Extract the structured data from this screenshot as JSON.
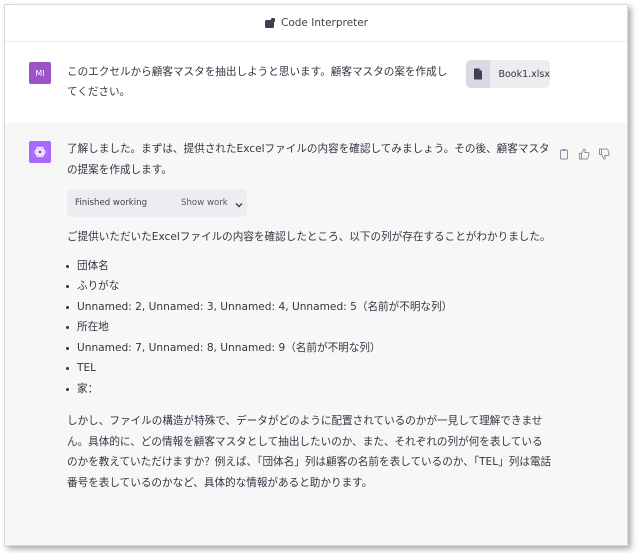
{
  "topbar": {
    "title": "Code Interpreter",
    "icon": "plugin-icon"
  },
  "user": {
    "avatar": "MI",
    "message": "このエクセルから顧客マスタを抽出しようと思います。顧客マスタの案を作成してください。",
    "file": {
      "name": "Book1.xlsx",
      "icon": "file-icon"
    }
  },
  "assistant": {
    "intro": "了解しました。まずは、提供されたExcelファイルの内容を確認してみましょう。その後、顧客マスタの提案を作成します。",
    "working": {
      "status": "Finished working",
      "toggle": "Show work"
    },
    "found": "ご提供いただいたExcelファイルの内容を確認したところ、以下の列が存在することがわかりました。",
    "columns": [
      "団体名",
      "ふりがな",
      "Unnamed: 2, Unnamed: 3, Unnamed: 4, Unnamed: 5（名前が不明な列）",
      "所在地",
      "Unnamed: 7, Unnamed: 8, Unnamed: 9（名前が不明な列）",
      "TEL",
      "家："
    ],
    "closing": "しかし、ファイルの構造が特殊で、データがどのように配置されているのかが一見して理解できません。具体的に、どの情報を顧客マスタとして抽出したいのか、また、それぞれの列が何を表しているのかを教えていただけますか？例えば、「団体名」列は顧客の名前を表しているのか、「TEL」列は電話番号を表しているのかなど、具体的な情報があると助かります。",
    "feedback": [
      "copy-icon",
      "thumbs-up-icon",
      "thumbs-down-icon"
    ]
  },
  "colors": {
    "user_avatar": "#9a54c6",
    "gpt_avatar": "#ab68ff",
    "assistant_bg": "#f7f7f8"
  }
}
